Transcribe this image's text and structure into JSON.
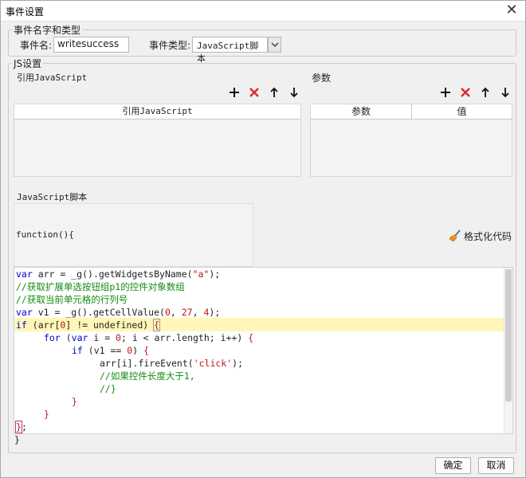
{
  "window": {
    "title": "事件设置",
    "close": "✕"
  },
  "name_group": {
    "legend": "事件名字和类型",
    "event_name_label": "事件名:",
    "event_name_value": "writesuccess",
    "event_type_label": "事件类型:",
    "event_type_value": "JavaScript脚本"
  },
  "js_group": {
    "legend": "JS设置",
    "ref_section_title": "引用JavaScript",
    "ref_table_header": "引用JavaScript",
    "param_section_title": "参数",
    "param_headers": [
      "参数",
      "值"
    ],
    "toolbar_icons": [
      "plus-icon",
      "delete-icon",
      "arrow-up-icon",
      "arrow-down-icon"
    ],
    "script_title": "JavaScript脚本",
    "function_header": "function(){",
    "format_label": "格式化代码",
    "closing_brace": "}",
    "highlight_color": "#fff6b8"
  },
  "code": {
    "line1": [
      "var",
      " arr = _g().getWidgetsByName(",
      "\"a\"",
      ");"
    ],
    "line2": "//获取扩展单选按钮组p1的控件对象数组",
    "line3": "//获取当前单元格的行列号",
    "line4": [
      "var",
      " v1 = _g().getCellValue(",
      "0",
      ", ",
      "27",
      ", ",
      "4",
      ");"
    ],
    "line5": [
      "if",
      " (arr[",
      "0",
      "] != undefined) ",
      "{"
    ],
    "line6": [
      "for",
      " (",
      "var",
      " i = ",
      "0",
      "; i < arr.length; i++) ",
      "{"
    ],
    "line7": [
      "if",
      " (v1 == ",
      "0",
      ") ",
      "{"
    ],
    "line8": [
      "arr[i].fireEvent(",
      "'click'",
      ");"
    ],
    "line9": "//如果控件长度大于1,",
    "line10": "//}",
    "line11": "}",
    "line12": "}",
    "line13": [
      "}",
      ";"
    ]
  },
  "buttons": {
    "ok": "确定",
    "cancel": "取消"
  }
}
